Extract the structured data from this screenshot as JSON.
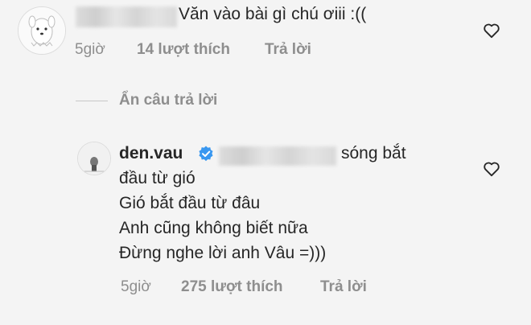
{
  "comment1": {
    "text": "Văn vào bài gì chú ơiii :((",
    "time": "5giờ",
    "likes": "14 lượt thích",
    "reply_label": "Trả lời",
    "icons": {
      "like": "heart-outline-icon",
      "avatar": "ghost-dog-avatar"
    }
  },
  "hide_replies": {
    "label": "Ẩn câu trả lời"
  },
  "reply": {
    "username": "den.vau",
    "verified": true,
    "line1_rest": "sóng bắt",
    "lines": [
      "đầu từ gió",
      "Gió bắt đầu từ đâu",
      "Anh cũng không biết nữa",
      "Đừng nghe lời anh Vâu =)))"
    ],
    "time": "5giờ",
    "likes": "275 lượt thích",
    "reply_label": "Trả lời",
    "icons": {
      "like": "heart-outline-icon",
      "verified": "verified-badge-icon"
    }
  },
  "colors": {
    "text": "#262626",
    "meta": "#8e8e8e",
    "verified": "#3897f0",
    "background": "#f4f4f4"
  }
}
